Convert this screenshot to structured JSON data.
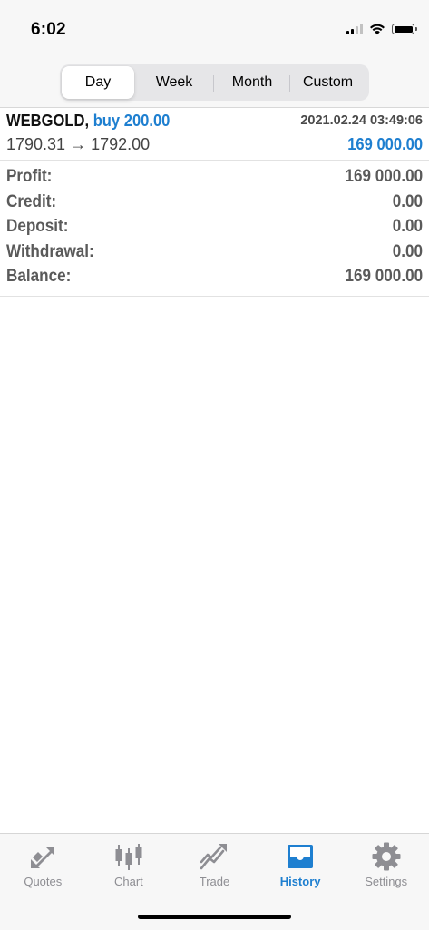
{
  "status_bar": {
    "time": "6:02"
  },
  "period_tabs": [
    {
      "label": "Day",
      "active": true
    },
    {
      "label": "Week",
      "active": false
    },
    {
      "label": "Month",
      "active": false
    },
    {
      "label": "Custom",
      "active": false
    }
  ],
  "deal": {
    "symbol": "WEBGOLD,",
    "action": "buy 200.00",
    "datetime": "2021.02.24 03:49:06",
    "prices": "1790.31 → 1792.00",
    "profit": "169 000.00"
  },
  "summary": [
    {
      "label": "Profit:",
      "value": "169 000.00"
    },
    {
      "label": "Credit:",
      "value": "0.00"
    },
    {
      "label": "Deposit:",
      "value": "0.00"
    },
    {
      "label": "Withdrawal:",
      "value": "0.00"
    },
    {
      "label": "Balance:",
      "value": "169 000.00"
    }
  ],
  "tab_bar": [
    {
      "label": "Quotes",
      "icon": "quotes-icon",
      "active": false
    },
    {
      "label": "Chart",
      "icon": "candlestick-chart-icon",
      "active": false
    },
    {
      "label": "Trade",
      "icon": "trade-icon",
      "active": false
    },
    {
      "label": "History",
      "icon": "history-inbox-icon",
      "active": true
    },
    {
      "label": "Settings",
      "icon": "gear-icon",
      "active": false
    }
  ],
  "colors": {
    "accent": "#1e7fd0",
    "inactive_icon": "#8e8e93",
    "label_gray": "#5a5a5a"
  }
}
